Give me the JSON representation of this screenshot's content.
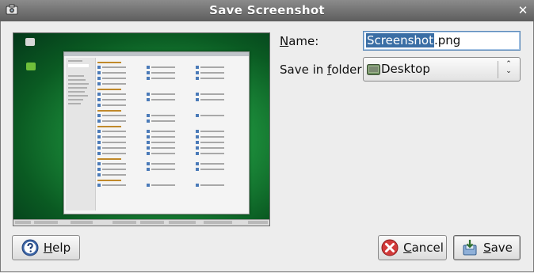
{
  "window": {
    "title": "Save Screenshot",
    "close_glyph": "✕",
    "app_icon": "camera-icon",
    "close_icon": "close-icon"
  },
  "form": {
    "name_label_mnemonic": "N",
    "name_label_rest": "ame:",
    "name_value_selected": "Screenshot",
    "name_value_rest": ".png",
    "folder_label_start": "Save in ",
    "folder_label_mnemonic": "f",
    "folder_label_rest": "older:",
    "folder_value": "Desktop",
    "folder_icon": "desktop-folder-icon",
    "folder_arrows_up": "⌃",
    "folder_arrows_down": "⌄"
  },
  "buttons": {
    "help_mnemonic": "H",
    "help_rest": "elp",
    "help_icon": "help-icon",
    "cancel_mnemonic": "C",
    "cancel_rest": "ancel",
    "cancel_icon": "cancel-icon",
    "save_mnemonic": "S",
    "save_rest": "ave",
    "save_icon": "save-icon"
  },
  "colors": {
    "titlebar": "#6f6f6f",
    "selection": "#3a6ea5",
    "preview_background": "#1d8f3c"
  }
}
